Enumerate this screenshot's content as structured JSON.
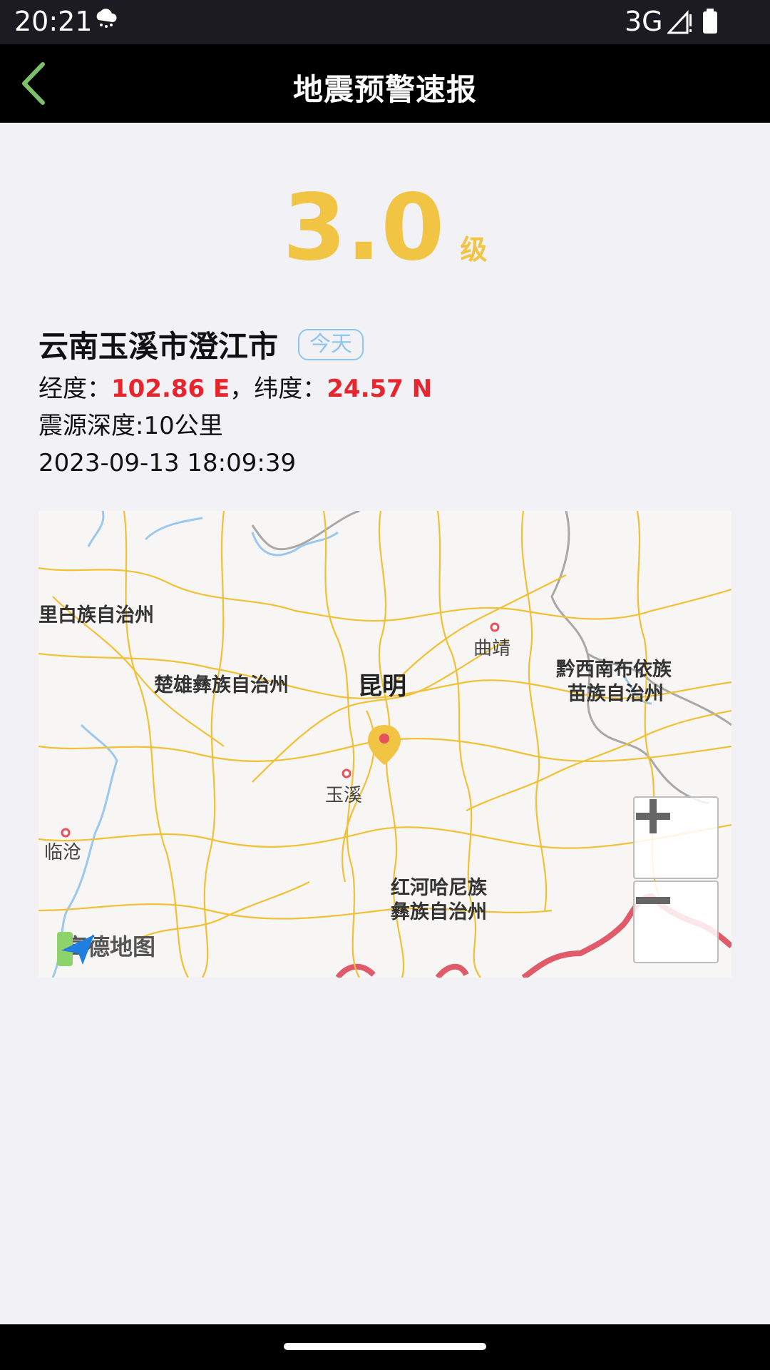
{
  "status_bar": {
    "time": "20:21",
    "network": "3G",
    "weather_icon": "cloud-snow-icon",
    "signal_icon": "signal-icon",
    "battery_icon": "battery-icon"
  },
  "header": {
    "title": "地震预警速报",
    "back_icon": "chevron-left-icon",
    "back_color": "#7dc06a"
  },
  "quake": {
    "magnitude": "3.0",
    "magnitude_unit": "级",
    "magnitude_color": "#f2c444",
    "location": "云南玉溪市澄江市",
    "badge": "今天",
    "lon_label": "经度：",
    "lon_value": "102.86 E",
    "sep": "，",
    "lat_label": "纬度：",
    "lat_value": "24.57 N",
    "depth": "震源深度:10公里",
    "datetime": "2023-09-13 18:09:39"
  },
  "map": {
    "labels": {
      "dali": "里白族自治州",
      "chuxiong": "楚雄彝族自治州",
      "kunming": "昆明",
      "qujing": "曲靖",
      "qianxinan_1": "黔西南布依族",
      "qianxinan_2": "苗族自治州",
      "yuxi": "玉溪",
      "lincang": "临沧",
      "honghe_1": "红河哈尼族",
      "honghe_2": "彝族自治州"
    },
    "logo_text": "高德地图",
    "zoom_in_icon": "plus-icon",
    "zoom_out_icon": "minus-icon"
  }
}
